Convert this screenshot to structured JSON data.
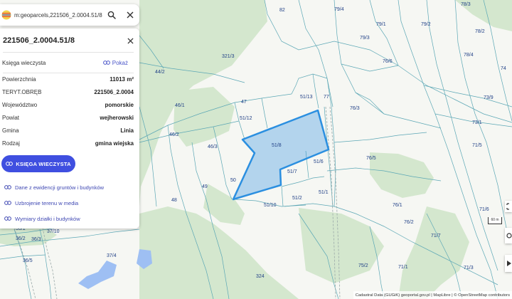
{
  "search": {
    "query": "m:geoparcels,221506_2.0004.51/8"
  },
  "panel": {
    "title": "221506_2.0004.51/8",
    "ksiega_label": "Księga wieczysta",
    "show_label": "Pokaż",
    "properties": [
      {
        "key": "Powierzchnia",
        "value": "11013 m²"
      },
      {
        "key": "TERYT.OBRĘB",
        "value": "221506_2.0004"
      },
      {
        "key": "Województwo",
        "value": "pomorskie"
      },
      {
        "key": "Powiat",
        "value": "wejherowski"
      },
      {
        "key": "Gmina",
        "value": "Linia"
      },
      {
        "key": "Rodzaj",
        "value": "gmina wiejska"
      }
    ],
    "kw_button_label": "KSIĘGA WIECZYSTA",
    "links": [
      "Dane z ewidencji gruntów i budynków",
      "Uzbrojenie terenu w media",
      "Wymiary działki i budynków"
    ]
  },
  "map": {
    "highlight_color": "#2b8fe0",
    "forest_color": "#d4e7ce",
    "water_color": "#9ebff3",
    "parcel_line_color": "#5ba7b5",
    "parcel_labels": [
      "82",
      "79/4",
      "78/3",
      "79/1",
      "79/2",
      "79/3",
      "78/2",
      "78/4",
      "321/3",
      "76/6",
      "44/2",
      "74",
      "51/13",
      "77",
      "73/9",
      "46/1",
      "47",
      "51/12",
      "76/3",
      "73/1",
      "46/2",
      "51/8",
      "46/3",
      "51/6",
      "76/5",
      "71/5",
      "51/7",
      "50",
      "49",
      "51/1",
      "48",
      "51/2",
      "76/1",
      "51/10",
      "71/6",
      "36/1",
      "37/10",
      "36/2",
      "36/3",
      "76/2",
      "71/7",
      "37/4",
      "36/5",
      "324",
      "75/2",
      "71/1",
      "71/3"
    ]
  },
  "scale": {
    "label": "60 m"
  },
  "attribution": "Cadastral Data (GUGiK) geoportal.gov.pl | MapLibre | © OpenStreetMap contributors"
}
